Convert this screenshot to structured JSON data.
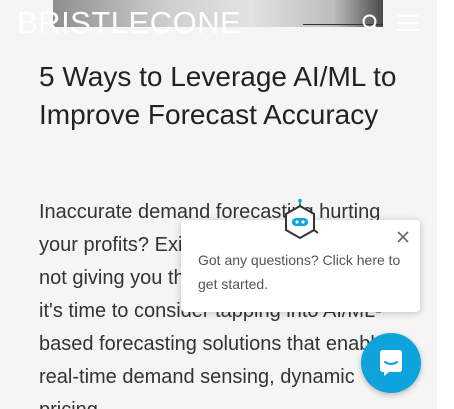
{
  "header": {
    "logo_text": "BRISTLECONE",
    "search_icon": "search-icon",
    "menu_icon": "hamburger-menu-icon"
  },
  "article": {
    "title": "5 Ways to Leverage AI/ML to Improve Forecast Accuracy",
    "intro": "Inaccurate demand forecasting hurting your profits? Existing forecasting tools not giving you the desired results? Then it's time to consider tapping into AI/ML-based forecasting solutions that enable real-time demand sensing, dynamic pricing..."
  },
  "chat": {
    "message": "Got any questions? Click here to get started.",
    "close_icon": "close-icon",
    "bot_icon": "chatbot-icon",
    "launcher_icon": "chat-bubble-icon"
  },
  "colors": {
    "page_bg": "#f5f5f5",
    "title": "#222222",
    "body": "#333333",
    "accent": "#0fa3dc",
    "popup_text": "#555555"
  }
}
